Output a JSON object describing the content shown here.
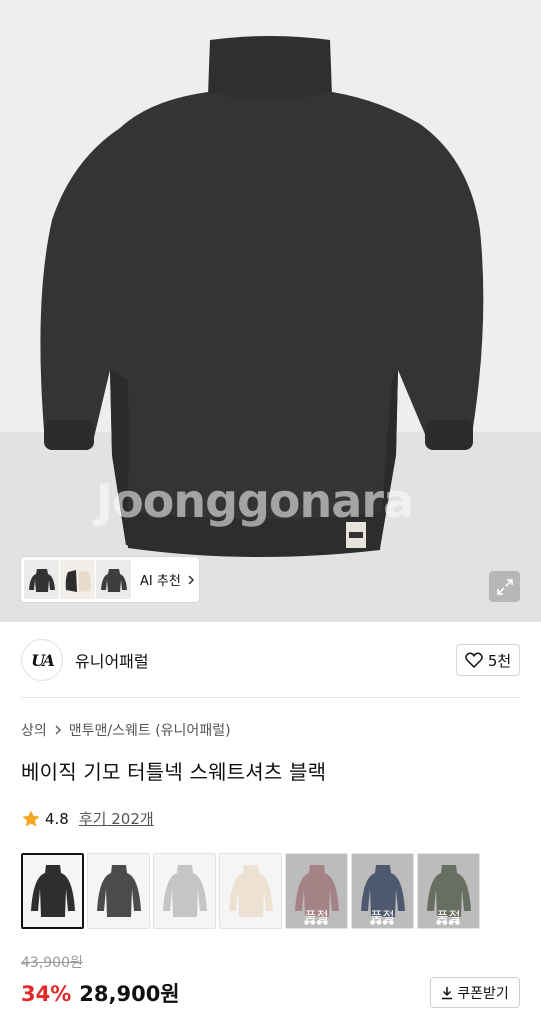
{
  "hero": {
    "watermark": "Joonggonara",
    "ai_recommend_label": "AI 추천"
  },
  "shop": {
    "logo_text": "UA",
    "name": "유니어패럴",
    "like_count": "5천"
  },
  "breadcrumb": {
    "category": "상의",
    "subcategory": "맨투맨/스웨트 (유니어패럴)"
  },
  "product": {
    "title": "베이직 기모 터틀넥 스웨트셔츠 블랙",
    "rating": "4.8",
    "reviews": "후기 202개",
    "original_price": "43,900원",
    "discount": "34%",
    "price": "28,900원",
    "coupon_label": "쿠폰받기"
  },
  "options": [
    {
      "color": "#2d2e2d",
      "selected": true,
      "soldout": ""
    },
    {
      "color": "#4a4c4a",
      "selected": false,
      "soldout": ""
    },
    {
      "color": "#c4c5c4",
      "selected": false,
      "soldout": ""
    },
    {
      "color": "#ede2d2",
      "selected": false,
      "soldout": ""
    },
    {
      "color": "#c98a92",
      "selected": false,
      "soldout": "품절"
    },
    {
      "color": "#2d3f66",
      "selected": false,
      "soldout": "품절"
    },
    {
      "color": "#5d6650",
      "selected": false,
      "soldout": "품절"
    }
  ],
  "colors": {
    "discount": "#e22a2a",
    "star": "#f5a623"
  }
}
